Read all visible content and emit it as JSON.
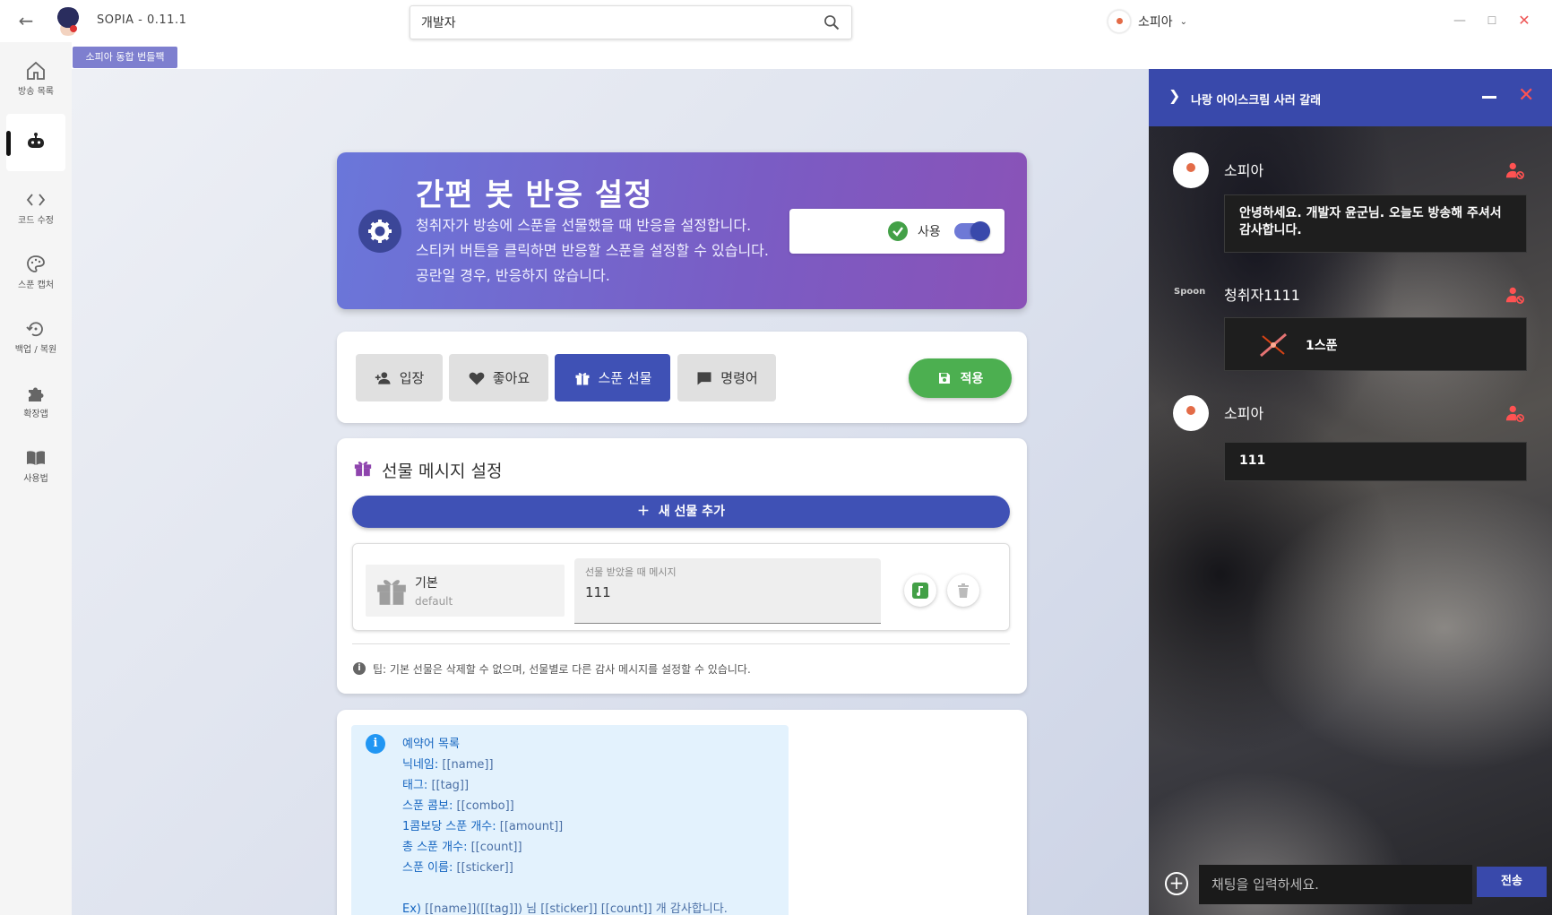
{
  "app": {
    "title": "SOPIA - 0.11.1"
  },
  "search": {
    "value": "개발자"
  },
  "user": {
    "name": "소피아"
  },
  "sidebar": {
    "items": [
      {
        "label": "방송 목록"
      },
      {
        "label": ""
      },
      {
        "label": "코드 수정"
      },
      {
        "label": "스푼 캡처"
      },
      {
        "label": "백업 / 복원"
      },
      {
        "label": "확장앱"
      },
      {
        "label": "사용법"
      }
    ]
  },
  "banner_chip": "소피아 동합 번들팩",
  "header": {
    "title": "간편 봇 반응 설정",
    "desc": [
      "청취자가 방송에 스푼을 선물했을 때 반응을 설정합니다.",
      "스티커 버튼을 클릭하면 반응할 스푼을 설정할 수 있습니다.",
      "공란일 경우, 반응하지 않습니다."
    ],
    "toggle_label": "사용",
    "toggle_on": true
  },
  "tabs": {
    "items": [
      {
        "label": "입장"
      },
      {
        "label": "좋아요"
      },
      {
        "label": "스푼 선물"
      },
      {
        "label": "명령어"
      }
    ],
    "active": "스푼 선물",
    "apply_label": "적용"
  },
  "gift": {
    "title": "선물 메시지 설정",
    "add_label": "새 선물 추가",
    "rows": [
      {
        "name": "기본",
        "sub": "default",
        "field_label": "선물 받았을 때 메시지",
        "value": "111"
      }
    ],
    "tip": "팁: 기본 선물은 삭제할 수 없으며, 선물별로 다른 감사 메시지를 설정할 수 있습니다."
  },
  "vars": {
    "title": "예약어 목록",
    "lines": [
      {
        "label": "닉네임:",
        "value": "[[name]]"
      },
      {
        "label": "태그:",
        "value": "[[tag]]"
      },
      {
        "label": "스푼 콤보:",
        "value": "[[combo]]"
      },
      {
        "label": "1콤보당 스푼 개수:",
        "value": "[[amount]]"
      },
      {
        "label": "총 스푼 개수:",
        "value": "[[count]]"
      },
      {
        "label": "스푼 이름:",
        "value": "[[sticker]]"
      }
    ],
    "example_label": "Ex)",
    "example_value": "[[name]]([[tag]]) 님 [[sticker]] [[count]] 개 감사합니다."
  },
  "chat": {
    "title": "나랑 아이스크림 사러 갈래",
    "messages": [
      {
        "name": "소피아",
        "text": "안녕하세요. 개발자 윤군님. 오늘도 방송해 주셔서 감사합니다."
      },
      {
        "name": "청취자1111",
        "badge": "Spoon",
        "text": "1스푼"
      },
      {
        "name": "소피아",
        "text": "111"
      }
    ],
    "input_placeholder": "채팅을 입력하세요.",
    "send_label": "전송"
  }
}
